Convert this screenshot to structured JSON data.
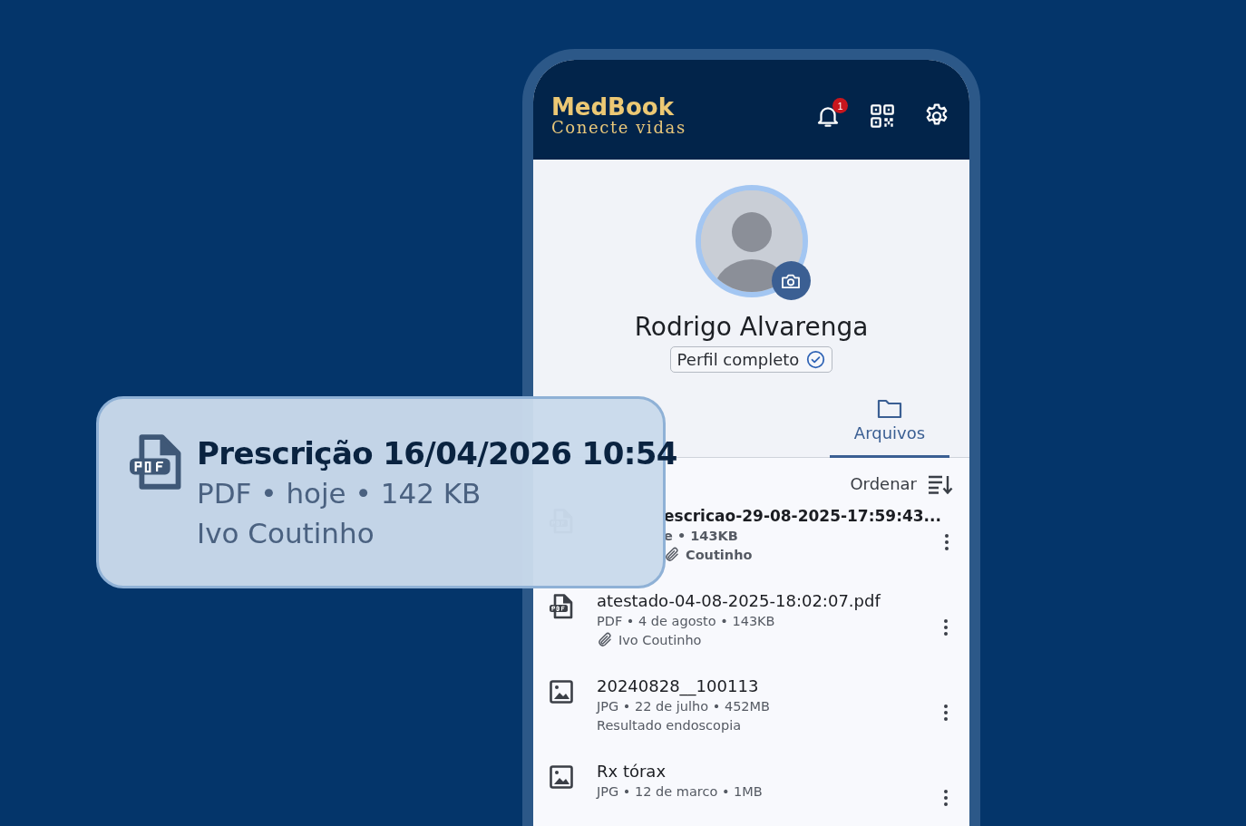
{
  "app": {
    "logo_title": "MedBook",
    "logo_subtitle": "Conecte vidas",
    "notification_count": "1"
  },
  "profile": {
    "name": "Rodrigo Alvarenga",
    "status": "Perfil completo"
  },
  "tabs": [
    {
      "label": "Arquivos",
      "selected": true
    }
  ],
  "toolbar": {
    "sort_label": "Ordenar"
  },
  "files": [
    {
      "kind": "pdf",
      "title": "escricao-29-08-2025-17:59:43...",
      "meta": "e • 143KB",
      "note": "Coutinho",
      "attached": true
    },
    {
      "kind": "pdf",
      "title": "atestado-04-08-2025-18:02:07.pdf",
      "meta": "PDF • 4 de agosto • 143KB",
      "note": "Ivo Coutinho",
      "attached": true
    },
    {
      "kind": "image",
      "title": "20240828__100113",
      "meta": "JPG • 22 de julho • 452MB",
      "note": "Resultado endoscopia",
      "attached": false
    },
    {
      "kind": "image",
      "title": "Rx tórax",
      "meta": "JPG • 12 de marco • 1MB",
      "attached": false
    }
  ],
  "highlight_card": {
    "kind": "pdf",
    "title": "Prescrição 16/04/2026 10:54",
    "meta": "PDF • hoje • 142 KB",
    "note": "Ivo Coutinho"
  }
}
